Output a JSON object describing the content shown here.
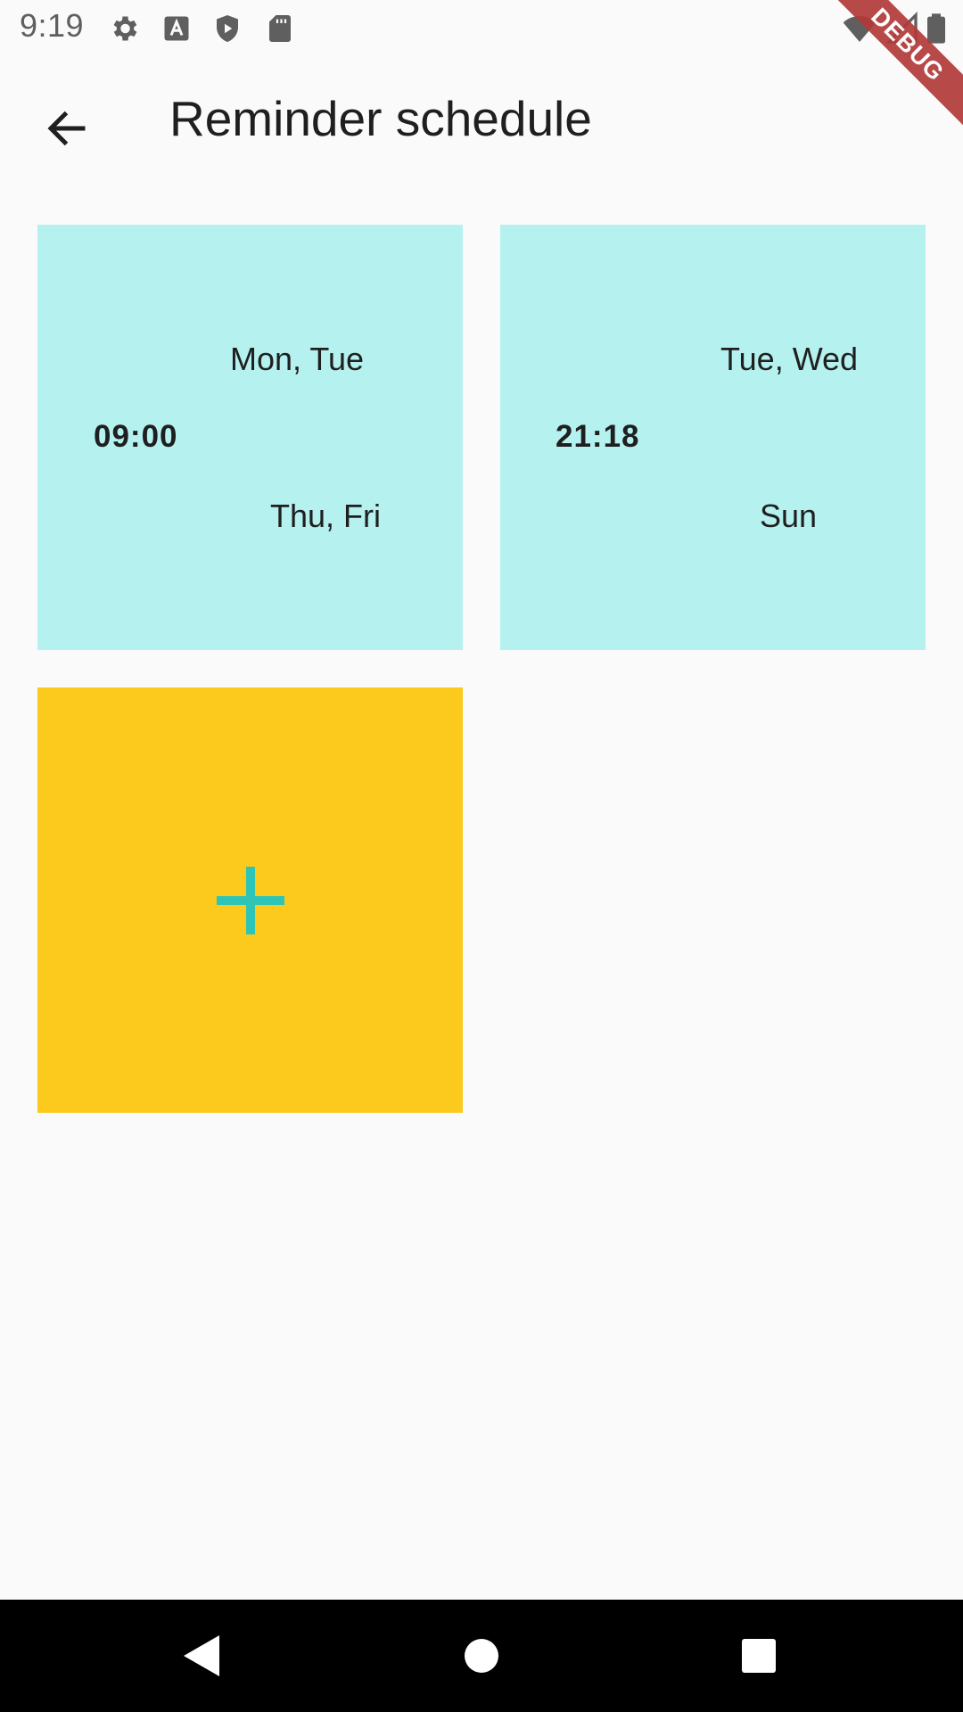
{
  "status_bar": {
    "time": "9:19",
    "left_icons": [
      "settings-gear-icon",
      "a-text-icon",
      "shield-play-icon",
      "sd-card-icon"
    ],
    "right_icons": [
      "wifi-icon",
      "cellular-signal-icon",
      "battery-icon"
    ]
  },
  "debug_banner": {
    "label": "DEBUG"
  },
  "app_bar": {
    "title": "Reminder schedule",
    "back_icon": "arrow-back-icon"
  },
  "schedules": [
    {
      "time": "09:00",
      "days_line1": "Mon, Tue",
      "days_line2": "Thu, Fri"
    },
    {
      "time": "21:18",
      "days_line1": "Tue, Wed",
      "days_line2": "Sun"
    }
  ],
  "add_tile": {
    "icon": "plus-icon"
  },
  "nav_bar": {
    "buttons": [
      "back-triangle-icon",
      "home-circle-icon",
      "recents-square-icon"
    ]
  },
  "colors": {
    "schedule_tile": "#b4f1ef",
    "add_tile": "#fcca1c",
    "plus_accent": "#2ec4b6",
    "debug_ribbon": "#b33a3a",
    "background": "#fafafa"
  }
}
